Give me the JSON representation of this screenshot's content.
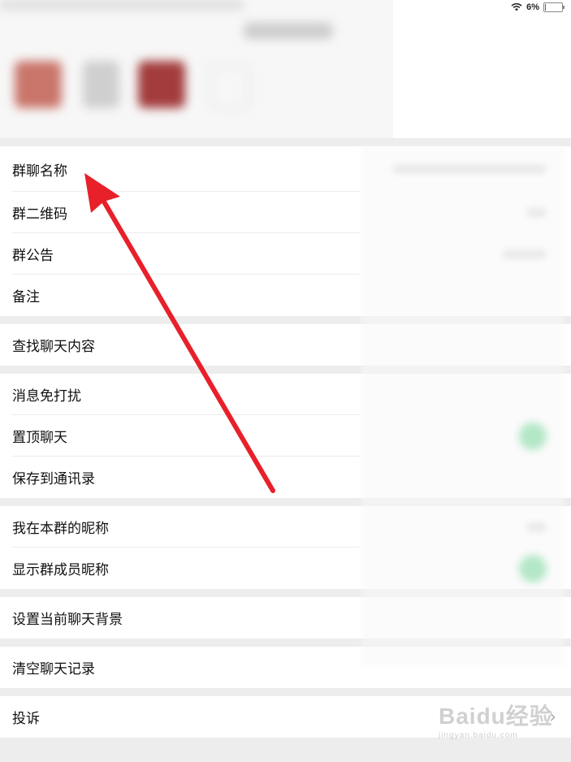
{
  "status_bar": {
    "battery_pct": "6%",
    "battery_level": 0.06
  },
  "groups": [
    {
      "rows": [
        {
          "label": "群聊名称",
          "name": "row-group-name"
        },
        {
          "label": "群二维码",
          "name": "row-group-qrcode"
        },
        {
          "label": "群公告",
          "name": "row-group-announcement"
        },
        {
          "label": "备注",
          "name": "row-remark"
        }
      ]
    },
    {
      "rows": [
        {
          "label": "查找聊天内容",
          "name": "row-search-chat"
        }
      ]
    },
    {
      "rows": [
        {
          "label": "消息免打扰",
          "name": "row-mute"
        },
        {
          "label": "置顶聊天",
          "name": "row-pin"
        },
        {
          "label": "保存到通讯录",
          "name": "row-save-contacts"
        }
      ]
    },
    {
      "rows": [
        {
          "label": "我在本群的昵称",
          "name": "row-my-nickname"
        },
        {
          "label": "显示群成员昵称",
          "name": "row-show-nicknames"
        }
      ]
    },
    {
      "rows": [
        {
          "label": "设置当前聊天背景",
          "name": "row-chat-background"
        }
      ]
    },
    {
      "rows": [
        {
          "label": "清空聊天记录",
          "name": "row-clear-history"
        }
      ]
    },
    {
      "rows": [
        {
          "label": "投诉",
          "name": "row-complain"
        }
      ]
    }
  ],
  "watermark": {
    "logo": "Baidu经验",
    "url": "jingyan.baidu.com"
  },
  "colors": {
    "annotation_arrow": "#e8202a",
    "toggle_on": "#5fd38a"
  }
}
